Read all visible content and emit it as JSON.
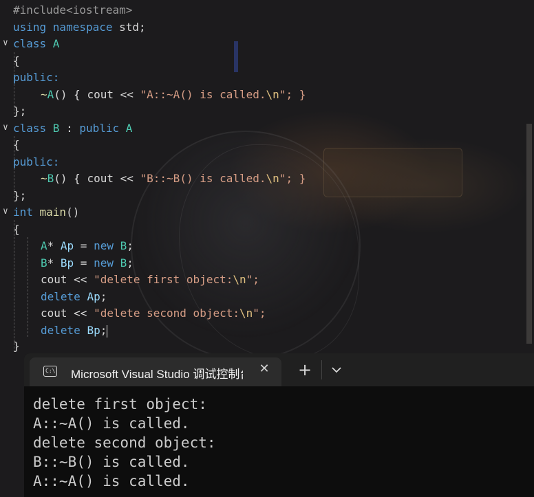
{
  "code": {
    "l1": "#include<iostream>",
    "l2a": "using namespace ",
    "l2b": "std;",
    "l3a": "class ",
    "l3b": "A",
    "l4": "{",
    "l5": "public:",
    "l6a": "~",
    "l6b": "A",
    "l6c": "() { cout << ",
    "l6d": "\"A::~A() is called.",
    "l6e": "\\n",
    "l6f": "\"; }",
    "l7": "};",
    "l8a": "class ",
    "l8b": "B",
    "l8c": " : ",
    "l8d": "public ",
    "l8e": "A",
    "l9": "{",
    "l10": "public:",
    "l11a": "~",
    "l11b": "B",
    "l11c": "() { cout << ",
    "l11d": "\"B::~B() is called.",
    "l11e": "\\n",
    "l11f": "\"; }",
    "l12": "};",
    "l13a": "int ",
    "l13b": "main",
    "l13c": "()",
    "l14": "{",
    "l15a": "A",
    "l15b": "* ",
    "l15c": "Ap",
    "l15d": " = ",
    "l15e": "new ",
    "l15f": "B",
    "l15g": ";",
    "l16a": "B",
    "l16b": "* ",
    "l16c": "Bp",
    "l16d": " = ",
    "l16e": "new ",
    "l16f": "B",
    "l16g": ";",
    "l17a": "cout << ",
    "l17b": "\"delete first object:",
    "l17c": "\\n",
    "l17d": "\";",
    "l18a": "delete ",
    "l18b": "Ap",
    "l18c": ";",
    "l19a": "cout << ",
    "l19b": "\"delete second object:",
    "l19c": "\\n",
    "l19d": "\";",
    "l20a": "delete ",
    "l20b": "Bp",
    "l20c": ";",
    "l21": "}"
  },
  "terminal": {
    "tab_title": "Microsoft Visual Studio 调试控制台",
    "tab_icon_text": "C:\\",
    "close_glyph": "✕",
    "add_glyph": "+",
    "output": [
      "delete first object:",
      "A::~A() is called.",
      "delete second object:",
      "B::~B() is called.",
      "A::~A() is called."
    ]
  },
  "icons": {
    "fold": "chevron-down-icon",
    "terminal": "console-icon",
    "close": "close-icon",
    "add": "plus-icon",
    "dropdown": "chevron-down-icon"
  }
}
